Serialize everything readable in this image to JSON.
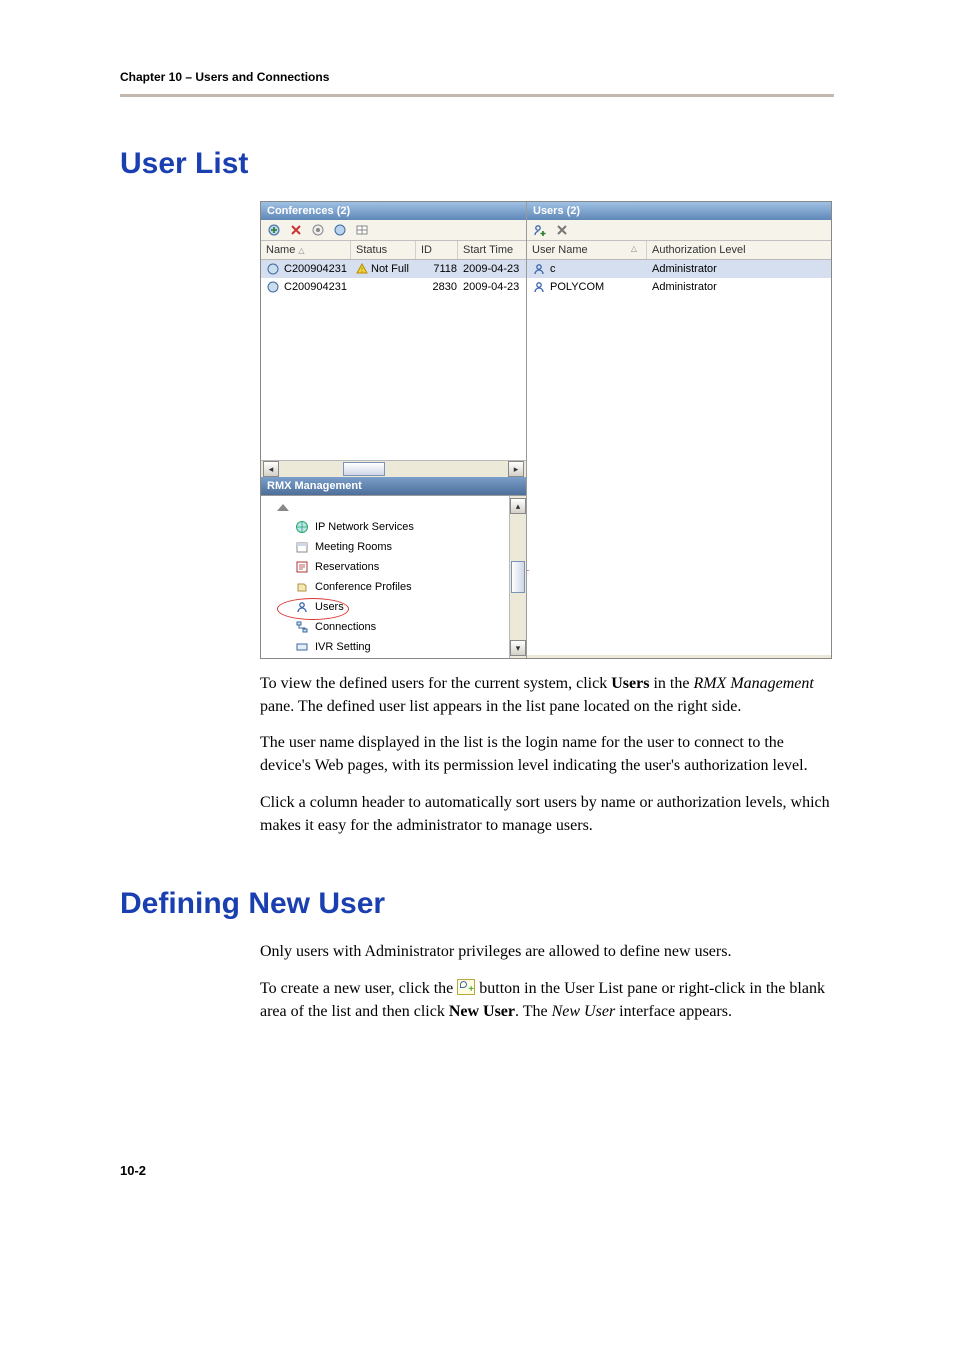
{
  "header": {
    "chapter_line": "Chapter 10 – Users and Connections"
  },
  "section1": {
    "title": "User List",
    "para1_pre": "To view the defined users for the current system, click ",
    "para1_bold": "Users",
    "para1_mid": " in the ",
    "para1_ital": "RMX Management",
    "para1_post": " pane. The defined user list appears in the list pane located on the right side.",
    "para2": "The user name displayed in the list is the login name for the user to connect to the device's Web pages, with its permission level indicating the user's authorization level.",
    "para3": "Click a column header to automatically sort users by name or authorization levels, which makes it easy for the administrator to manage users."
  },
  "section2": {
    "title": "Defining New User",
    "para1": "Only users with Administrator privileges are allowed to define new users.",
    "para2_pre": "To create a new user, click the ",
    "para2_mid": " button in the User List pane or right-click in the blank area of the list and then click ",
    "para2_bold": "New User",
    "para2_mid2": ". The ",
    "para2_ital": "New User",
    "para2_post": " interface appears."
  },
  "footer": {
    "page_num": "10-2"
  },
  "shot": {
    "conferences": {
      "title": "Conferences (2)",
      "columns": {
        "name": "Name",
        "status": "Status",
        "id": "ID",
        "start": "Start Time"
      },
      "rows": [
        {
          "name": "C200904231",
          "status": "Not Full",
          "id": "7118",
          "start": "2009-04-23",
          "warn": true,
          "sel": true
        },
        {
          "name": "C200904231",
          "status": "",
          "id": "2830",
          "start": "2009-04-23",
          "warn": false,
          "sel": false
        }
      ]
    },
    "users": {
      "title": "Users (2)",
      "columns": {
        "name": "User Name",
        "level": "Authorization Level"
      },
      "rows": [
        {
          "name": "c",
          "level": "Administrator",
          "sel": true
        },
        {
          "name": "POLYCOM",
          "level": "Administrator",
          "sel": false
        }
      ]
    },
    "rmx": {
      "title": "RMX Management",
      "items": [
        "IP Network Services",
        "Meeting Rooms",
        "Reservations",
        "Conference Profiles",
        "Users",
        "Connections",
        "IVR Setting"
      ]
    }
  }
}
